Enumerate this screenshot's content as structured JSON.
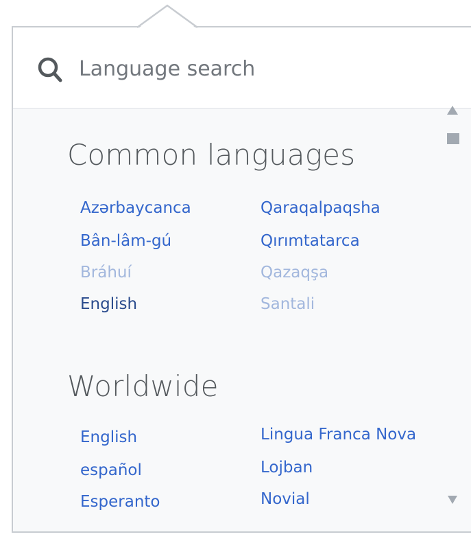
{
  "search": {
    "placeholder": "Language search",
    "value": ""
  },
  "sections": {
    "common": {
      "title": "Common languages",
      "col1": [
        "Azərbaycanca",
        "Bân-lâm-gú",
        "Bráhuí",
        "English"
      ],
      "col2": [
        "Qaraqalpaqsha",
        "Qırımtatarca",
        "Qazaqşa",
        "Santali"
      ]
    },
    "worldwide": {
      "title": "Worldwide",
      "col1": [
        "English",
        "español",
        "Esperanto"
      ],
      "col2": [
        "Lingua Franca Nova",
        "Lojban",
        "Novial"
      ]
    }
  },
  "colors": {
    "link": "#3366cc",
    "link_dim": "#a2b7dd",
    "link_visited": "#2a4b8d",
    "panel_bg": "#f8f9fa",
    "border": "#c8ccd1"
  },
  "icons": {
    "search": "search-icon",
    "scroll_up": "scroll-up-arrow-icon",
    "scroll_down": "scroll-down-arrow-icon"
  }
}
